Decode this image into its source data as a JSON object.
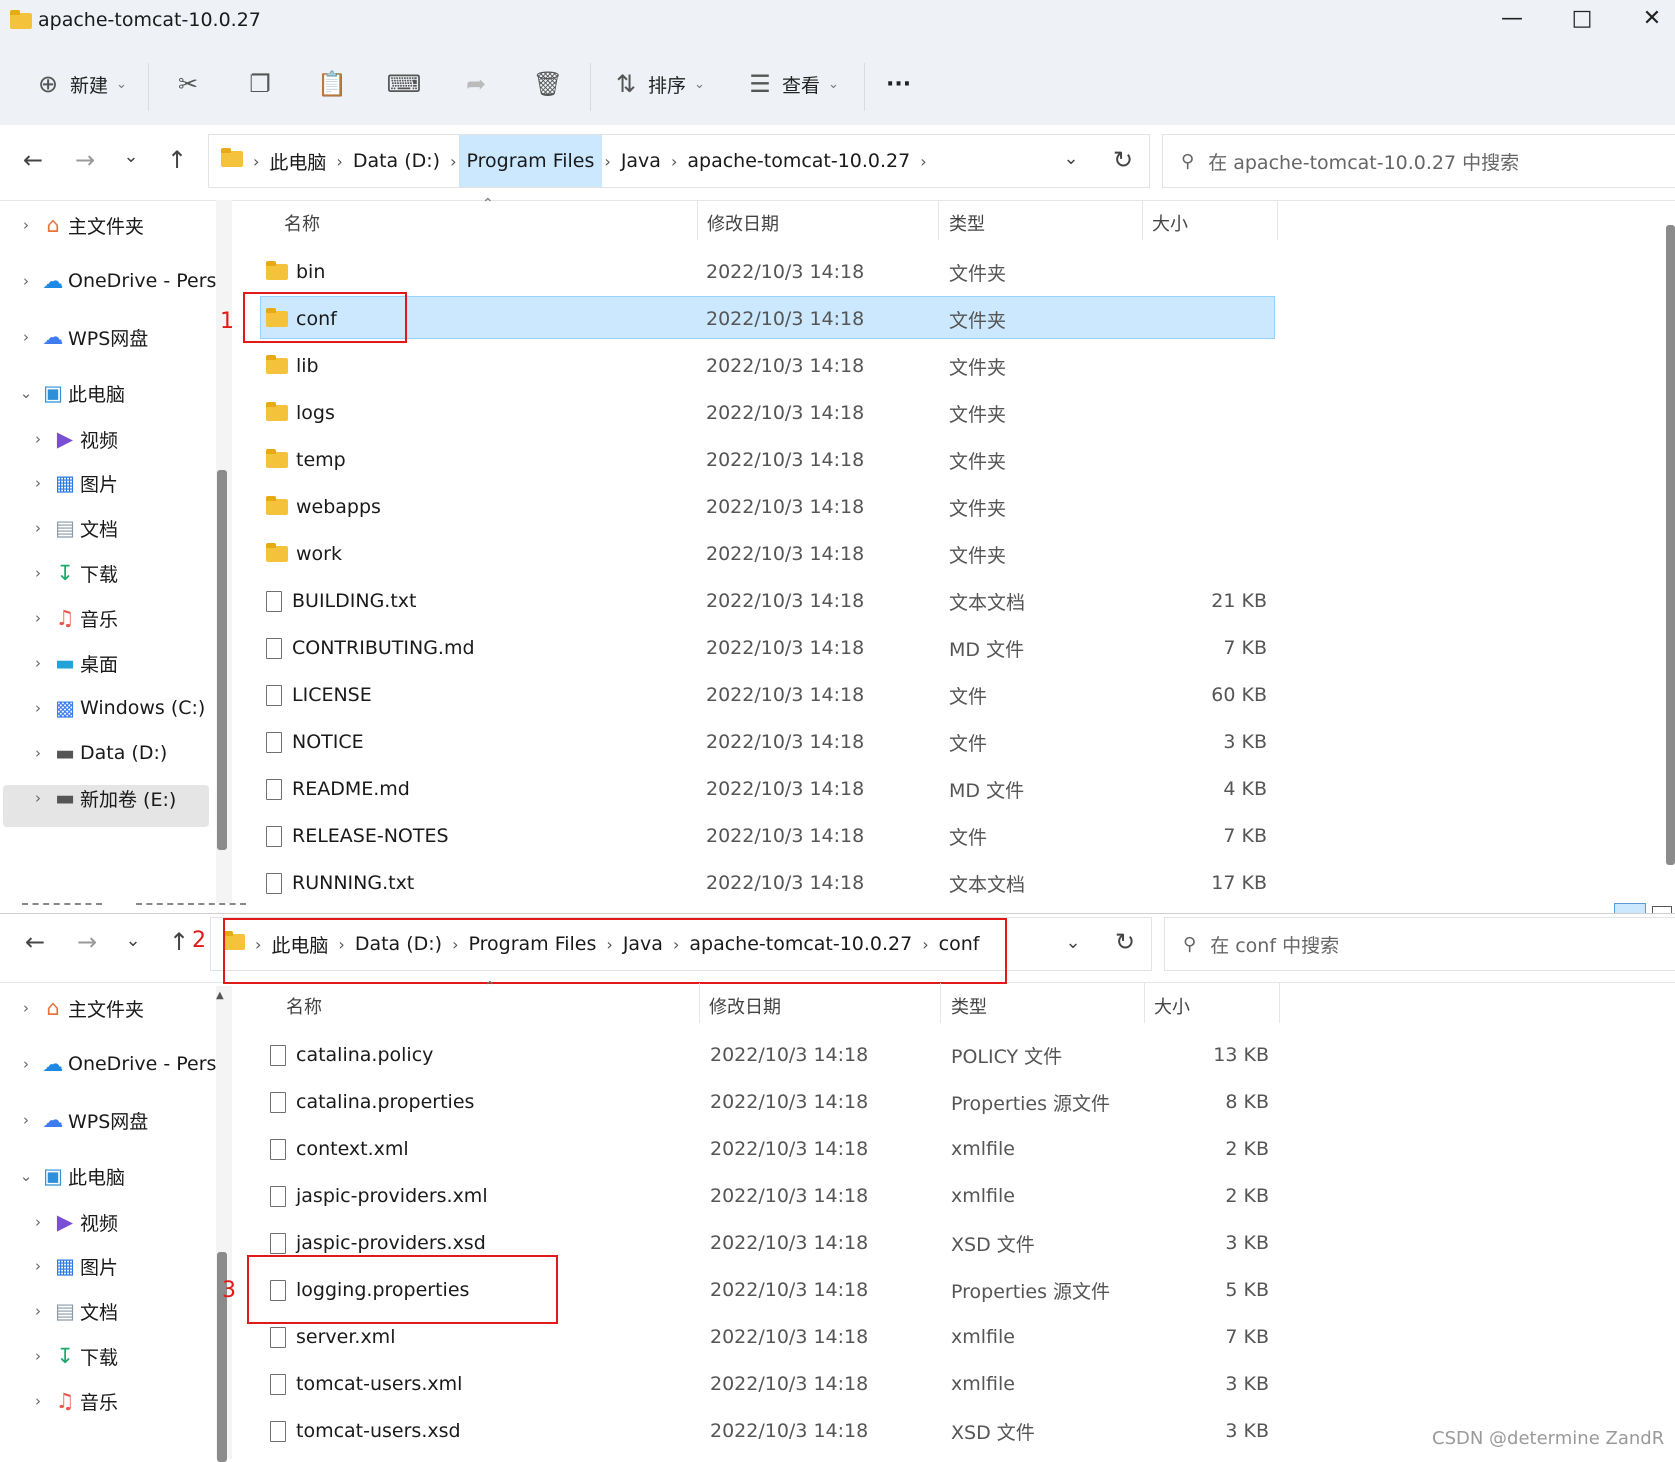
{
  "window1": {
    "title": "apache-tomcat-10.0.27",
    "toolbar": {
      "new_label": "新建",
      "sort_label": "排序",
      "view_label": "查看",
      "more_label": "···"
    },
    "breadcrumb": [
      "此电脑",
      "Data (D:)",
      "Program Files",
      "Java",
      "apache-tomcat-10.0.27"
    ],
    "search_placeholder": "在 apache-tomcat-10.0.27 中搜索",
    "sidebar": [
      {
        "label": "主文件夹",
        "icon": "home-icon"
      },
      {
        "label": "OneDrive - Pers",
        "icon": "onedrive-icon"
      },
      {
        "label": "WPS网盘",
        "icon": "wps-cloud-icon"
      },
      {
        "label": "此电脑",
        "icon": "pc-icon"
      },
      {
        "label": "视频",
        "icon": "video-icon"
      },
      {
        "label": "图片",
        "icon": "pictures-icon"
      },
      {
        "label": "文档",
        "icon": "documents-icon"
      },
      {
        "label": "下载",
        "icon": "download-icon"
      },
      {
        "label": "音乐",
        "icon": "music-icon"
      },
      {
        "label": "桌面",
        "icon": "desktop-icon"
      },
      {
        "label": "Windows (C:)",
        "icon": "drive-c-icon"
      },
      {
        "label": "Data (D:)",
        "icon": "drive-icon"
      },
      {
        "label": "新加卷 (E:)",
        "icon": "drive-icon"
      }
    ],
    "columns": {
      "name": "名称",
      "date": "修改日期",
      "type": "类型",
      "size": "大小"
    },
    "files": [
      {
        "name": "bin",
        "date": "2022/10/3 14:18",
        "type": "文件夹",
        "size": "",
        "kind": "folder"
      },
      {
        "name": "conf",
        "date": "2022/10/3 14:18",
        "type": "文件夹",
        "size": "",
        "kind": "folder"
      },
      {
        "name": "lib",
        "date": "2022/10/3 14:18",
        "type": "文件夹",
        "size": "",
        "kind": "folder"
      },
      {
        "name": "logs",
        "date": "2022/10/3 14:18",
        "type": "文件夹",
        "size": "",
        "kind": "folder"
      },
      {
        "name": "temp",
        "date": "2022/10/3 14:18",
        "type": "文件夹",
        "size": "",
        "kind": "folder"
      },
      {
        "name": "webapps",
        "date": "2022/10/3 14:18",
        "type": "文件夹",
        "size": "",
        "kind": "folder"
      },
      {
        "name": "work",
        "date": "2022/10/3 14:18",
        "type": "文件夹",
        "size": "",
        "kind": "folder"
      },
      {
        "name": "BUILDING.txt",
        "date": "2022/10/3 14:18",
        "type": "文本文档",
        "size": "21 KB",
        "kind": "file"
      },
      {
        "name": "CONTRIBUTING.md",
        "date": "2022/10/3 14:18",
        "type": "MD 文件",
        "size": "7 KB",
        "kind": "file"
      },
      {
        "name": "LICENSE",
        "date": "2022/10/3 14:18",
        "type": "文件",
        "size": "60 KB",
        "kind": "file"
      },
      {
        "name": "NOTICE",
        "date": "2022/10/3 14:18",
        "type": "文件",
        "size": "3 KB",
        "kind": "file"
      },
      {
        "name": "README.md",
        "date": "2022/10/3 14:18",
        "type": "MD 文件",
        "size": "4 KB",
        "kind": "file"
      },
      {
        "name": "RELEASE-NOTES",
        "date": "2022/10/3 14:18",
        "type": "文件",
        "size": "7 KB",
        "kind": "file"
      },
      {
        "name": "RUNNING.txt",
        "date": "2022/10/3 14:18",
        "type": "文本文档",
        "size": "17 KB",
        "kind": "file"
      }
    ],
    "annotation": "1"
  },
  "window2": {
    "breadcrumb": [
      "此电脑",
      "Data (D:)",
      "Program Files",
      "Java",
      "apache-tomcat-10.0.27",
      "conf"
    ],
    "search_placeholder": "在 conf 中搜索",
    "sidebar": [
      {
        "label": "主文件夹",
        "icon": "home-icon"
      },
      {
        "label": "OneDrive - Pers",
        "icon": "onedrive-icon"
      },
      {
        "label": "WPS网盘",
        "icon": "wps-cloud-icon"
      },
      {
        "label": "此电脑",
        "icon": "pc-icon"
      },
      {
        "label": "视频",
        "icon": "video-icon"
      },
      {
        "label": "图片",
        "icon": "pictures-icon"
      },
      {
        "label": "文档",
        "icon": "documents-icon"
      },
      {
        "label": "下载",
        "icon": "download-icon"
      },
      {
        "label": "音乐",
        "icon": "music-icon"
      }
    ],
    "columns": {
      "name": "名称",
      "date": "修改日期",
      "type": "类型",
      "size": "大小"
    },
    "files": [
      {
        "name": "catalina.policy",
        "date": "2022/10/3 14:18",
        "type": "POLICY 文件",
        "size": "13 KB"
      },
      {
        "name": "catalina.properties",
        "date": "2022/10/3 14:18",
        "type": "Properties 源文件",
        "size": "8 KB"
      },
      {
        "name": "context.xml",
        "date": "2022/10/3 14:18",
        "type": "xmlfile",
        "size": "2 KB"
      },
      {
        "name": "jaspic-providers.xml",
        "date": "2022/10/3 14:18",
        "type": "xmlfile",
        "size": "2 KB"
      },
      {
        "name": "jaspic-providers.xsd",
        "date": "2022/10/3 14:18",
        "type": "XSD 文件",
        "size": "3 KB"
      },
      {
        "name": "logging.properties",
        "date": "2022/10/3 14:18",
        "type": "Properties 源文件",
        "size": "5 KB"
      },
      {
        "name": "server.xml",
        "date": "2022/10/3 14:18",
        "type": "xmlfile",
        "size": "7 KB"
      },
      {
        "name": "tomcat-users.xml",
        "date": "2022/10/3 14:18",
        "type": "xmlfile",
        "size": "3 KB"
      },
      {
        "name": "tomcat-users.xsd",
        "date": "2022/10/3 14:18",
        "type": "XSD 文件",
        "size": "3 KB"
      }
    ],
    "annotation_nav": "2",
    "annotation_file": "3"
  },
  "watermark": "CSDN @determine  ZandR",
  "colors": {
    "selection": "#cce8ff",
    "annotation_red": "#e11919",
    "folder": "#f5c33b"
  }
}
